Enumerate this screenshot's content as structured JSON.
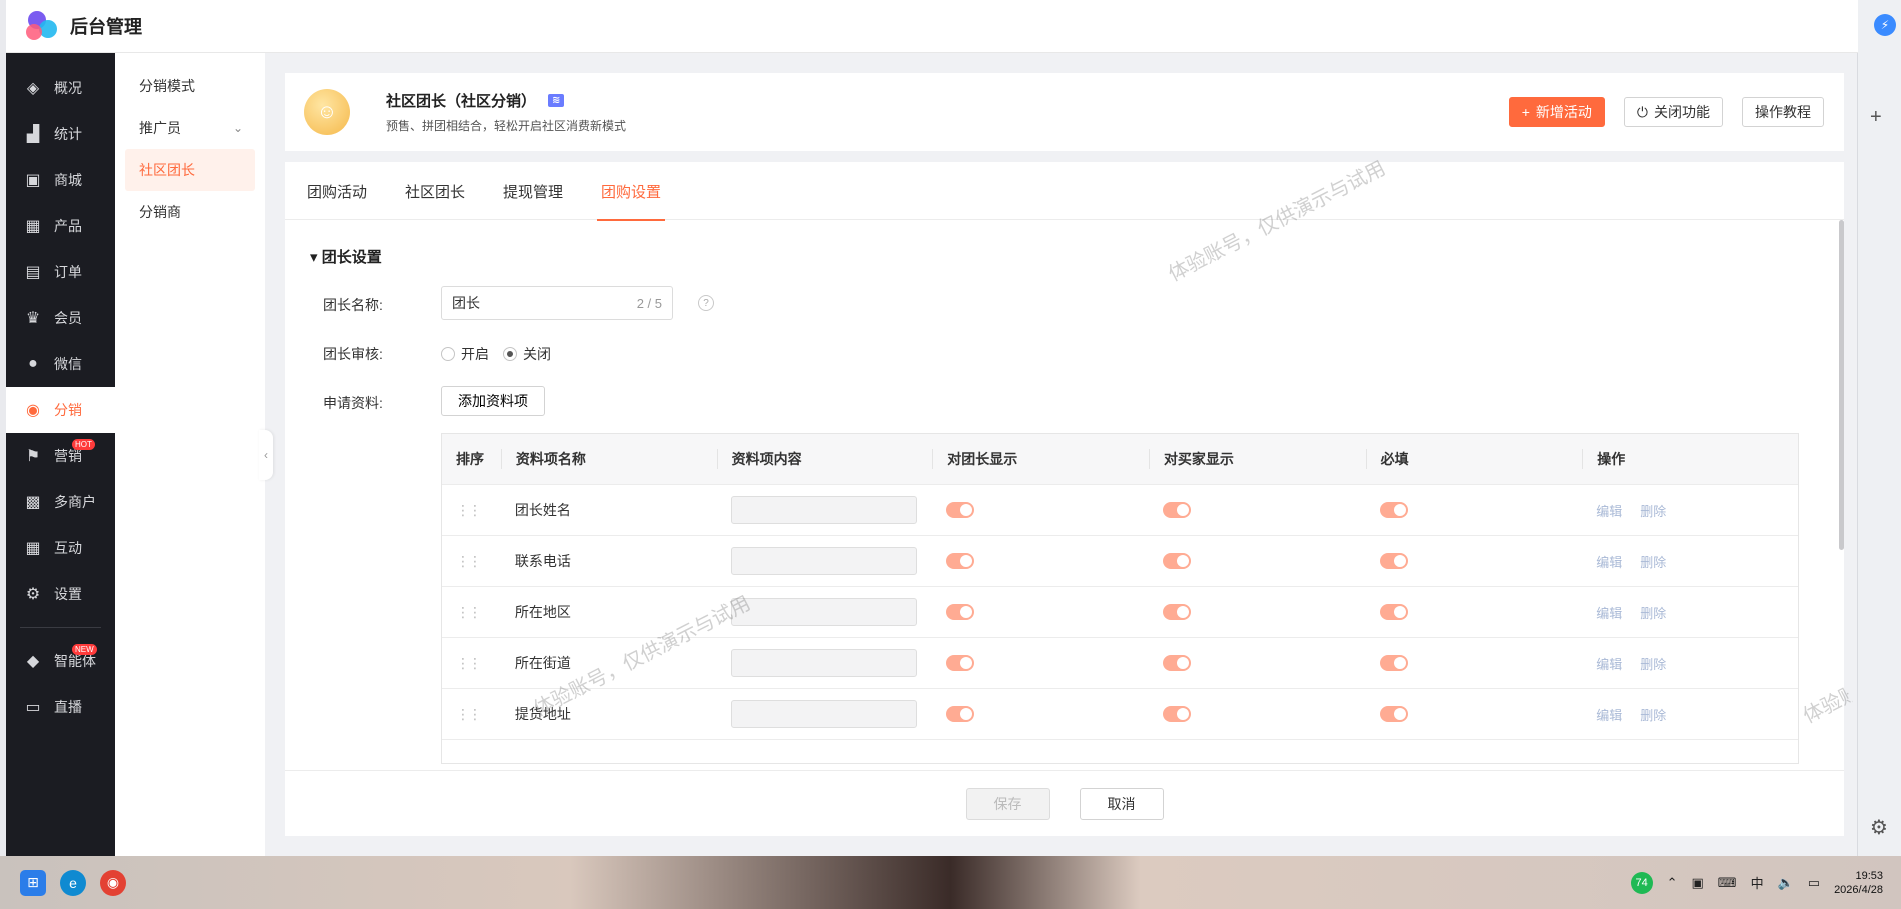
{
  "app": {
    "brand": "后台管理"
  },
  "sidemenu": {
    "items": [
      {
        "label": "概况",
        "icon": "layers-icon",
        "glyph": "◈"
      },
      {
        "label": "统计",
        "icon": "chart-icon",
        "glyph": "▟"
      },
      {
        "label": "商城",
        "icon": "shop-icon",
        "glyph": "▣"
      },
      {
        "label": "产品",
        "icon": "grid-icon",
        "glyph": "▦"
      },
      {
        "label": "订单",
        "icon": "order-icon",
        "glyph": "▤"
      },
      {
        "label": "会员",
        "icon": "crown-icon",
        "glyph": "♛"
      },
      {
        "label": "微信",
        "icon": "wechat-icon",
        "glyph": "●"
      },
      {
        "label": "分销",
        "icon": "users-icon",
        "glyph": "◉",
        "active": true
      },
      {
        "label": "营销",
        "icon": "flag-icon",
        "glyph": "⚑",
        "badge": "HOT"
      },
      {
        "label": "多商户",
        "icon": "merchant-icon",
        "glyph": "▩"
      },
      {
        "label": "互动",
        "icon": "interact-icon",
        "glyph": "▦"
      },
      {
        "label": "设置",
        "icon": "gear-icon",
        "glyph": "⚙"
      },
      {
        "label": "智能体",
        "icon": "agent-icon",
        "glyph": "◆",
        "badge": "NEW"
      },
      {
        "label": "直播",
        "icon": "tv-icon",
        "glyph": "▭"
      }
    ]
  },
  "submenu": {
    "items": [
      {
        "label": "分销模式"
      },
      {
        "label": "推广员",
        "chevron": "⌄"
      },
      {
        "label": "社区团长",
        "active": true
      },
      {
        "label": "分销商"
      }
    ]
  },
  "header": {
    "title": "社区团长（社区分销）",
    "tag": "≋",
    "desc": "预售、拼团相结合，轻松开启社区消费新模式",
    "actions": {
      "add": "新增活动",
      "close": "关闭功能",
      "tutorial": "操作教程"
    }
  },
  "tabs": [
    "团购活动",
    "社区团长",
    "提现管理",
    "团购设置"
  ],
  "active_tab": 3,
  "form": {
    "section": "团长设置",
    "name_label": "团长名称:",
    "name_value": "团长",
    "name_count": "2 / 5",
    "help": "?",
    "review_label": "团长审核:",
    "review_on": "开启",
    "review_off": "关闭",
    "review_value": "关闭",
    "material_label": "申请资料:",
    "add_button": "添加资料项"
  },
  "table": {
    "headers": [
      "排序",
      "资料项名称",
      "资料项内容",
      "对团长显示",
      "对买家显示",
      "必填",
      "操作"
    ],
    "rows": [
      {
        "name": "团长姓名"
      },
      {
        "name": "联系电话"
      },
      {
        "name": "所在地区"
      },
      {
        "name": "所在街道"
      },
      {
        "name": "提货地址"
      }
    ],
    "edit_label": "编辑",
    "delete_label": "删除"
  },
  "footer": {
    "save": "保存",
    "cancel": "取消"
  },
  "watermark": "体验账号，仅供演示与试用",
  "taskbar": {
    "badge": "74",
    "ime": "中",
    "time": "19:53",
    "date": "2026/4/28"
  },
  "colors": {
    "accent": "#ff6a3d",
    "sidebar": "#1b1c22",
    "toggle": "#ffab93"
  }
}
